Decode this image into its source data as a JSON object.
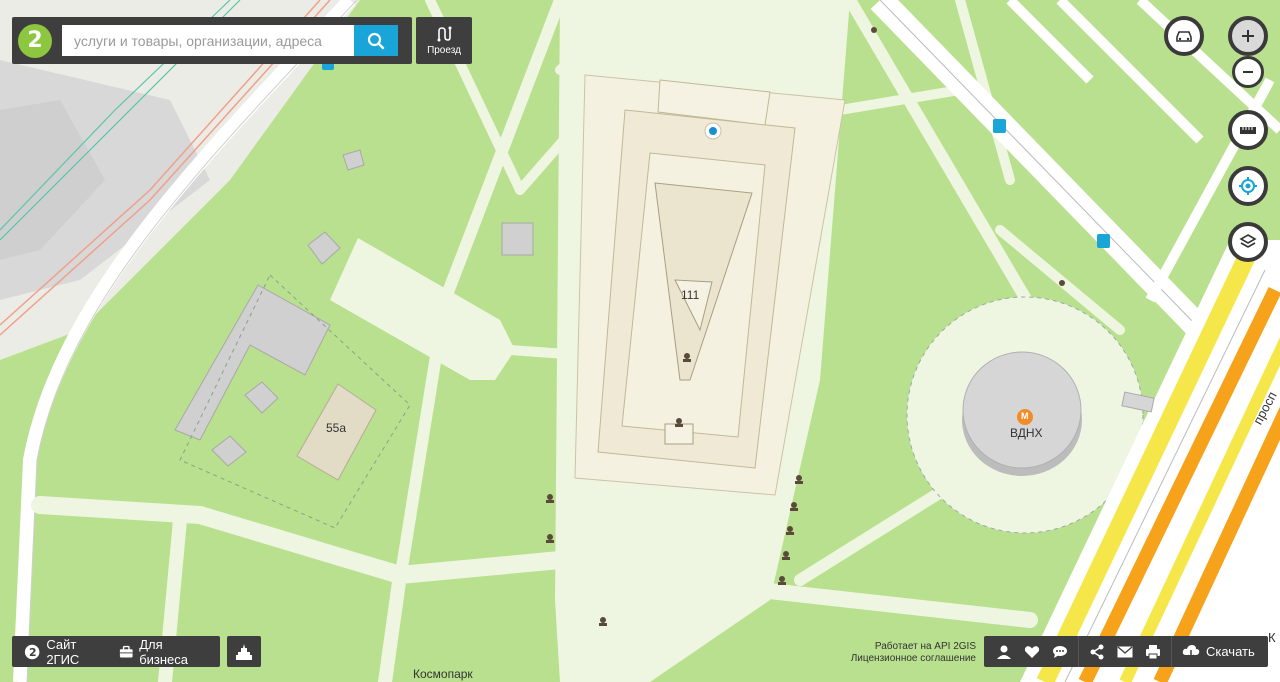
{
  "search": {
    "placeholder": "услуги и товары, организации, адреса"
  },
  "route": {
    "label": "Проезд"
  },
  "logo": {
    "text": "2"
  },
  "map_labels": {
    "building_111": "111",
    "building_55a": "55а",
    "metro_station": "ВДНХ",
    "metro_mark": "М",
    "street_kosmopark": "Космопарк",
    "street_prosp": "просп",
    "street_k": "К"
  },
  "footer": {
    "site_label": "Сайт 2ГИС",
    "business_label": "Для бизнеса",
    "api_credit": "Работает на API 2GIS",
    "license": "Лицензионное соглашение",
    "download_label": "Скачать"
  },
  "colors": {
    "park": "#b9e08e",
    "path": "#eef6e2",
    "building": "#d9d9d9",
    "pavilion": "#f5f1e0",
    "panel": "#3e3e3e",
    "accent": "#1aa5d8",
    "metro": "#f28c28",
    "highway_yellow": "#f5e64a",
    "highway_orange": "#f7a21b"
  },
  "icons": [
    "search-icon",
    "route-icon",
    "traffic-icon",
    "zoom-in-icon",
    "zoom-out-icon",
    "ruler-icon",
    "locate-icon",
    "layers-icon",
    "site-icon",
    "briefcase-icon",
    "landmark-icon",
    "account-icon",
    "favorites-icon",
    "chat-icon",
    "share-icon",
    "mail-icon",
    "print-icon",
    "download-icon"
  ]
}
